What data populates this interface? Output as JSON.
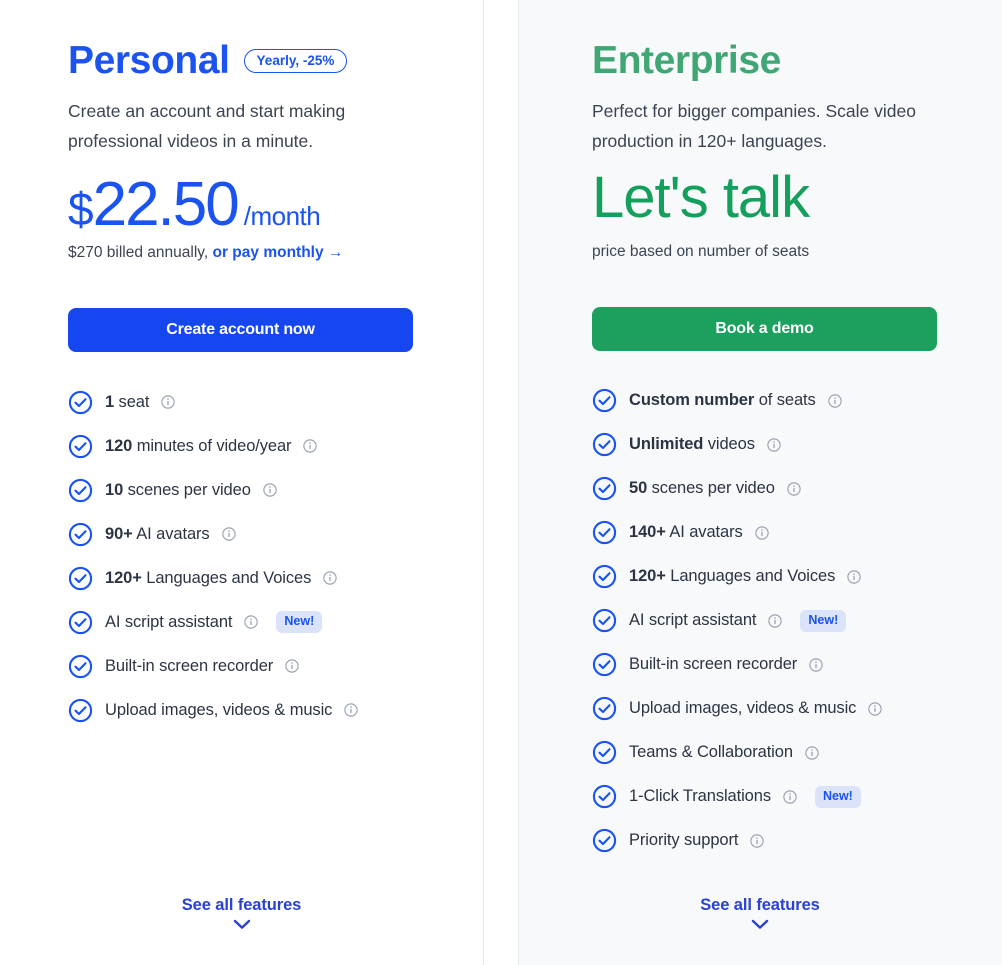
{
  "colors": {
    "personal_accent": "#1a53f0",
    "enterprise_accent": "#12a05c",
    "cta_blue": "#1546f0",
    "cta_green": "#1ba05e",
    "check": "#1a53f0",
    "badge_new_bg": "#dbe3fb",
    "enterprise_panel_bg": "#f8f9fb"
  },
  "plans": [
    {
      "id": "personal",
      "name": "Personal",
      "badge": "Yearly, -25%",
      "description": "Create an account and start making professional videos in a minute.",
      "price": {
        "currency": "$",
        "amount": "22.50",
        "period": "/month"
      },
      "price_note_prefix": "$270 billed annually, ",
      "price_note_link": "or pay monthly →",
      "cta_label": "Create account now",
      "features": [
        {
          "bold": "1",
          "rest": " seat",
          "info": "info-icon",
          "new": null
        },
        {
          "bold": "120",
          "rest": " minutes of video/year",
          "info": "info-icon",
          "new": null
        },
        {
          "bold": "10",
          "rest": " scenes per video",
          "info": "info-icon",
          "new": null
        },
        {
          "bold": "90+",
          "rest": " AI avatars",
          "info": "info-icon",
          "new": null
        },
        {
          "bold": "120+",
          "rest": " Languages and Voices",
          "info": "info-icon",
          "new": null
        },
        {
          "bold": "",
          "rest": "AI script assistant",
          "info": "info-icon",
          "new": "New!"
        },
        {
          "bold": "",
          "rest": "Built-in screen recorder",
          "info": "info-icon",
          "new": null
        },
        {
          "bold": "",
          "rest": "Upload images, videos & music",
          "info": "info-icon",
          "new": null
        }
      ],
      "see_all_label": "See all features"
    },
    {
      "id": "enterprise",
      "name": "Enterprise",
      "badge": null,
      "description": "Perfect for bigger companies. Scale video production in 120+ languages.",
      "price": null,
      "talk_text": "Let's talk",
      "talk_note": "price based on number of seats",
      "cta_label": "Book a demo",
      "features": [
        {
          "bold": "Custom number",
          "rest": " of seats",
          "info": "info-icon",
          "new": null
        },
        {
          "bold": "Unlimited",
          "rest": " videos",
          "info": "info-icon",
          "new": null
        },
        {
          "bold": "50",
          "rest": " scenes per video",
          "info": "info-icon",
          "new": null
        },
        {
          "bold": "140+",
          "rest": " AI avatars",
          "info": "info-icon",
          "new": null
        },
        {
          "bold": "120+",
          "rest": " Languages and Voices",
          "info": "info-icon",
          "new": null
        },
        {
          "bold": "",
          "rest": "AI script assistant",
          "info": "info-icon",
          "new": "New!"
        },
        {
          "bold": "",
          "rest": "Built-in screen recorder",
          "info": "info-icon",
          "new": null
        },
        {
          "bold": "",
          "rest": "Upload images, videos & music",
          "info": "info-icon",
          "new": null
        },
        {
          "bold": "",
          "rest": "Teams & Collaboration",
          "info": "info-icon",
          "new": null
        },
        {
          "bold": "",
          "rest": "1-Click Translations",
          "info": "info-icon",
          "new": "New!"
        },
        {
          "bold": "",
          "rest": "Priority support",
          "info": "info-icon",
          "new": null
        }
      ],
      "see_all_label": "See all features"
    }
  ]
}
